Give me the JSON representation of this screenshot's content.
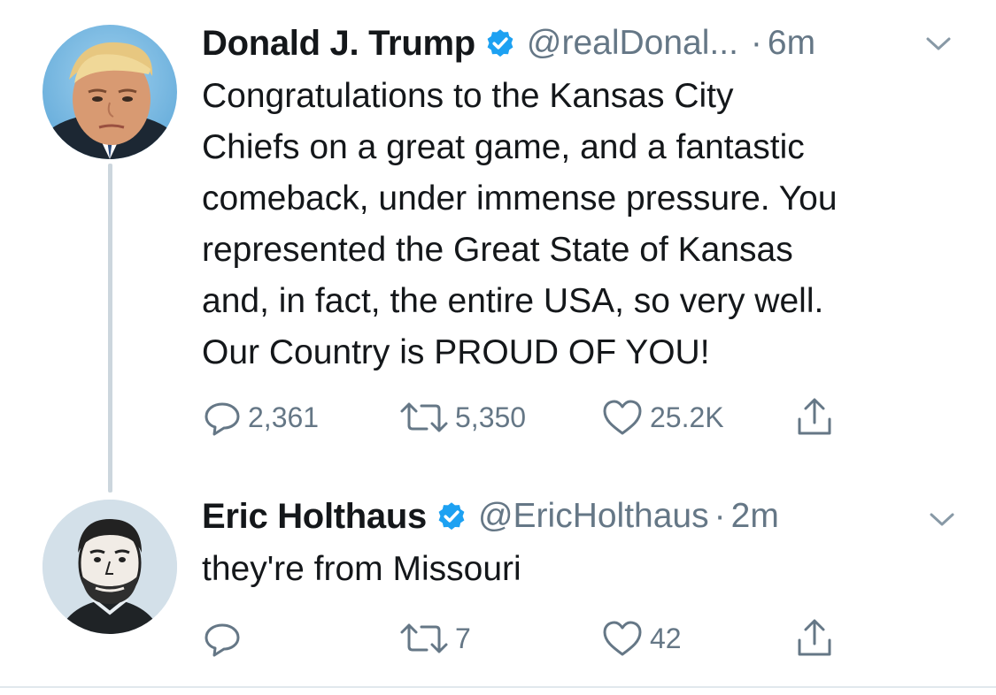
{
  "tweets": [
    {
      "name": "Donald J. Trump",
      "handle": "@realDonal...",
      "separator": "·",
      "time": "6m",
      "text": "Congratulations to the Kansas City\nChiefs on a great game, and a fantastic\ncomeback, under immense pressure. You\nrepresented the Great State of Kansas\nand, in fact, the entire USA, so very well.\nOur Country is PROUD OF YOU!",
      "replies": "2,361",
      "retweets": "5,350",
      "likes": "25.2K",
      "verified": true
    },
    {
      "name": "Eric Holthaus",
      "handle": "@EricHolthaus",
      "separator": "·",
      "time": "2m",
      "text": "they're from Missouri",
      "replies": "",
      "retweets": "7",
      "likes": "42",
      "verified": true
    }
  ],
  "colors": {
    "text": "#14171a",
    "secondary": "#657786",
    "verified_badge": "#1da1f2",
    "thread_line": "#ccd6dd"
  },
  "icons": [
    "reply-icon",
    "retweet-icon",
    "like-icon",
    "share-icon",
    "verified-badge-icon",
    "caret-down-icon"
  ]
}
